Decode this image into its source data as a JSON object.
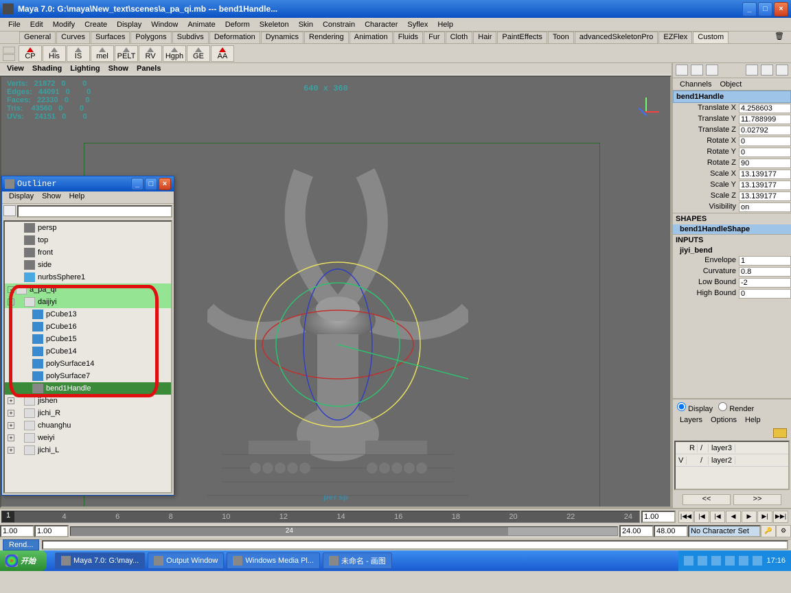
{
  "window": {
    "title": "Maya 7.0: G:\\maya\\New_text\\scenes\\a_pa_qi.mb   ---   bend1Handle..."
  },
  "menu": [
    "File",
    "Edit",
    "Modify",
    "Create",
    "Display",
    "Window",
    "Animate",
    "Deform",
    "Skeleton",
    "Skin",
    "Constrain",
    "Character",
    "Syflex",
    "Help"
  ],
  "shelfTabs": [
    "General",
    "Curves",
    "Surfaces",
    "Polygons",
    "Subdivs",
    "Deformation",
    "Dynamics",
    "Rendering",
    "Animation",
    "Fluids",
    "Fur",
    "Cloth",
    "Hair",
    "PaintEffects",
    "Toon",
    "advancedSkeletonPro",
    "EZFlex",
    "Custom"
  ],
  "activeShelf": "Custom",
  "shelfIcons": [
    "CP",
    "His",
    "IS",
    "mel",
    "PELT",
    "RV",
    "Hgph",
    "GE",
    "AA"
  ],
  "viewportMenu": [
    "View",
    "Shading",
    "Lighting",
    "Show",
    "Panels"
  ],
  "hud": {
    "dim": "640 x 360",
    "cam": "persp",
    "stats": [
      {
        "name": "Verts:",
        "val": "21872",
        "sel": "0",
        "x": "0"
      },
      {
        "name": "Edges:",
        "val": "44091",
        "sel": "0",
        "x": "0"
      },
      {
        "name": "Faces:",
        "val": "22330",
        "sel": "0",
        "x": "0"
      },
      {
        "name": "Tris:",
        "val": "43560",
        "sel": "0",
        "x": "0"
      },
      {
        "name": "UVs:",
        "val": "24151",
        "sel": "0",
        "x": "0"
      }
    ]
  },
  "channel": {
    "tabs": [
      "Channels",
      "Object"
    ],
    "name": "bend1Handle",
    "attrs": [
      {
        "l": "Translate X",
        "v": "4.258603"
      },
      {
        "l": "Translate Y",
        "v": "11.788999"
      },
      {
        "l": "Translate Z",
        "v": "0.02792"
      },
      {
        "l": "Rotate X",
        "v": "0"
      },
      {
        "l": "Rotate Y",
        "v": "0"
      },
      {
        "l": "Rotate Z",
        "v": "90"
      },
      {
        "l": "Scale X",
        "v": "13.139177"
      },
      {
        "l": "Scale Y",
        "v": "13.139177"
      },
      {
        "l": "Scale Z",
        "v": "13.139177"
      },
      {
        "l": "Visibility",
        "v": "on"
      }
    ],
    "shapesHead": "SHAPES",
    "shape": "bend1HandleShape",
    "inputsHead": "INPUTS",
    "input": "jiyi_bend",
    "inputAttrs": [
      {
        "l": "Envelope",
        "v": "1"
      },
      {
        "l": "Curvature",
        "v": "0.8"
      },
      {
        "l": "Low Bound",
        "v": "-2"
      },
      {
        "l": "High Bound",
        "v": "0"
      }
    ]
  },
  "displayRender": {
    "display": "Display",
    "render": "Render"
  },
  "layerMenu": [
    "Layers",
    "Options",
    "Help"
  ],
  "layers": [
    {
      "vis": "",
      "r": "R",
      "slash": "/",
      "name": "layer3"
    },
    {
      "vis": "V",
      "r": "",
      "slash": "/",
      "name": "layer2"
    }
  ],
  "nav": {
    "prev": "<<",
    "next": ">>"
  },
  "outlinerWin": {
    "title": "Outliner",
    "menu": [
      "Display",
      "Show",
      "Help"
    ],
    "items": [
      {
        "indent": 1,
        "type": "cam",
        "name": "persp"
      },
      {
        "indent": 1,
        "type": "cam",
        "name": "top"
      },
      {
        "indent": 1,
        "type": "cam",
        "name": "front"
      },
      {
        "indent": 1,
        "type": "cam",
        "name": "side"
      },
      {
        "indent": 1,
        "type": "nurbs",
        "name": "nurbsSphere1"
      },
      {
        "indent": 0,
        "type": "xform",
        "name": "a_pa_qi",
        "exp": "-",
        "sel": 1
      },
      {
        "indent": 1,
        "type": "xform",
        "name": "daijiyi",
        "exp": "-",
        "sel": 1
      },
      {
        "indent": 2,
        "type": "mesh",
        "name": "pCube13"
      },
      {
        "indent": 2,
        "type": "mesh",
        "name": "pCube16"
      },
      {
        "indent": 2,
        "type": "mesh",
        "name": "pCube15"
      },
      {
        "indent": 2,
        "type": "mesh",
        "name": "pCube14"
      },
      {
        "indent": 2,
        "type": "mesh",
        "name": "polySurface14"
      },
      {
        "indent": 2,
        "type": "mesh",
        "name": "polySurface7"
      },
      {
        "indent": 2,
        "type": "def",
        "name": "bend1Handle",
        "sel": 2
      },
      {
        "indent": 1,
        "type": "xform",
        "name": "jishen",
        "exp": "+"
      },
      {
        "indent": 1,
        "type": "xform",
        "name": "jichi_R",
        "exp": "+"
      },
      {
        "indent": 1,
        "type": "xform",
        "name": "chuanghu",
        "exp": "+"
      },
      {
        "indent": 1,
        "type": "xform",
        "name": "weiyi",
        "exp": "+"
      },
      {
        "indent": 1,
        "type": "xform",
        "name": "jichi_L",
        "exp": "+"
      }
    ]
  },
  "timeline": {
    "start": "1.00",
    "end": "1.00",
    "rangeStart": "1.00",
    "rangeEnd": "24.00",
    "playbackEnd": "48.00",
    "current": "1",
    "rangetext": "24",
    "ticks": [
      "1",
      "4",
      "6",
      "8",
      "10",
      "12",
      "14",
      "16",
      "18",
      "20",
      "22",
      "24"
    ],
    "charSet": "No Character Set"
  },
  "btm": {
    "rend": "Rend..."
  },
  "taskbar": {
    "start": "开始",
    "tasks": [
      {
        "label": "Maya 7.0: G:\\may...",
        "active": true
      },
      {
        "label": "Output Window"
      },
      {
        "label": "Windows Media Pl..."
      },
      {
        "label": "未命名 - 画图"
      }
    ],
    "time": "17:16"
  }
}
